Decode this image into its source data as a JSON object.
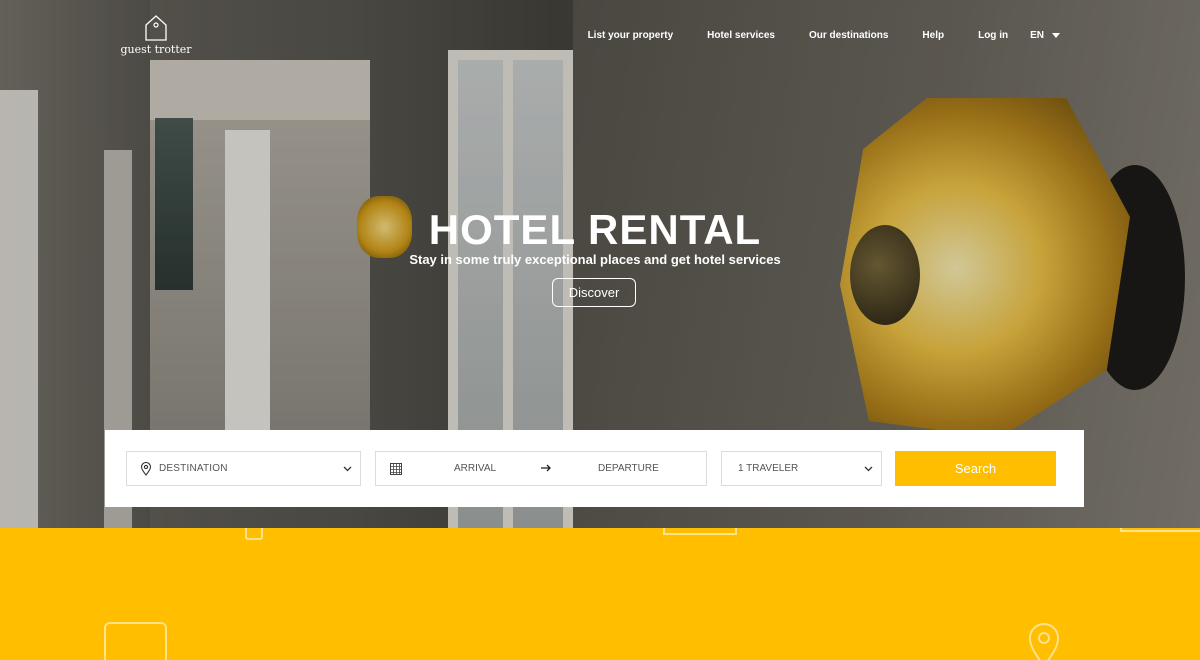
{
  "header": {
    "logo_text": "guest trotter",
    "nav": [
      {
        "label": "List your property"
      },
      {
        "label": "Hotel services"
      },
      {
        "label": "Our destinations"
      },
      {
        "label": "Help"
      },
      {
        "label": "Log in"
      }
    ],
    "language": "EN"
  },
  "hero": {
    "title": "HOTEL RENTAL",
    "subtitle": "Stay in some truly exceptional places and get hotel services",
    "cta_label": "Discover"
  },
  "search": {
    "destination_label": "DESTINATION",
    "arrival_label": "ARRIVAL",
    "departure_label": "DEPARTURE",
    "travelers_label": "1 TRAVELER",
    "button_label": "Search"
  },
  "colors": {
    "accent": "#ffbe00",
    "panel": "#ffffff",
    "text_light": "#ffffff",
    "field_text": "#555555"
  },
  "icons": {
    "logo": "house-tag-icon",
    "destination": "map-pin-icon",
    "dates": "calendar-icon",
    "date_separator": "arrow-right-icon",
    "select": "chevron-down-icon",
    "language": "caret-down-icon"
  }
}
